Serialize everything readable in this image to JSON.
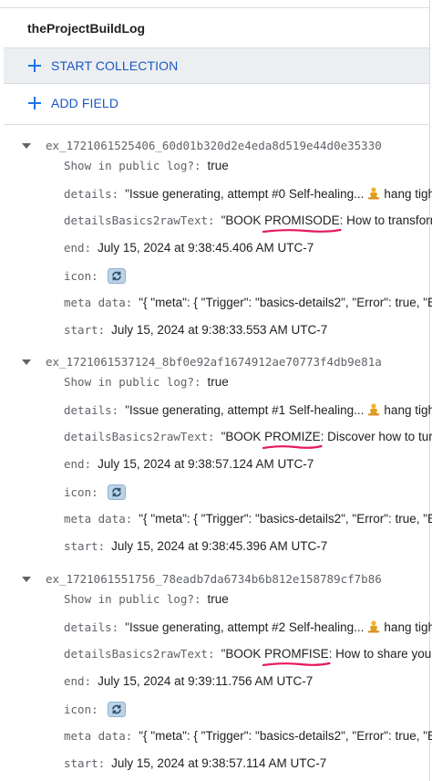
{
  "header": {
    "title": "theProjectBuildLog"
  },
  "actions": {
    "start_collection": "START COLLECTION",
    "add_field": "ADD FIELD"
  },
  "labels": {
    "show_in_public_log": "Show in public log?:",
    "details": "details:",
    "details_basics": "detailsBasics2rawText:",
    "end": "end:",
    "icon": "icon:",
    "meta_data": "meta data:",
    "start": "start:"
  },
  "documents": [
    {
      "id": "ex_1721061525406_60d01b320d2e4eda8d519e44d0e35330",
      "show_in_public_log": "true",
      "details_pre": "\"Issue generating, attempt #0 Self-healing...",
      "details_post": "hang tight!\"",
      "raw_pre": "\"BOOK ",
      "raw_hl": "PROMISODE",
      "raw_post": ": How to transform you",
      "end": "July 15, 2024 at 9:38:45.406 AM UTC-7",
      "meta_data": "\"{ \"meta\": { \"Trigger\": \"basics-details2\", \"Error\": true, \"Executi",
      "start": "July 15, 2024 at 9:38:33.553 AM UTC-7"
    },
    {
      "id": "ex_1721061537124_8bf0e92af1674912ae70773f4db9e81a",
      "show_in_public_log": "true",
      "details_pre": "\"Issue generating, attempt #1 Self-healing...",
      "details_post": "hang tight!\"",
      "raw_pre": "\"BOOK ",
      "raw_hl": "PROMIZE",
      "raw_post": ": Discover how to turn you",
      "end": "July 15, 2024 at 9:38:57.124 AM UTC-7",
      "meta_data": "\"{ \"meta\": { \"Trigger\": \"basics-details2\", \"Error\": true, \"Executi",
      "start": "July 15, 2024 at 9:38:45.396 AM UTC-7"
    },
    {
      "id": "ex_1721061551756_78eadb7da6734b6b812e158789cf7b86",
      "show_in_public_log": "true",
      "details_pre": "\"Issue generating, attempt #2 Self-healing...",
      "details_post": "hang tight!\"",
      "raw_pre": "\"BOOK ",
      "raw_hl": "PROMFISE",
      "raw_post": ": How to share your uniq",
      "end": "July 15, 2024 at 9:39:11.756 AM UTC-7",
      "meta_data": "\"{ \"meta\": { \"Trigger\": \"basics-details2\", \"Error\": true, \"Executi",
      "start": "July 15, 2024 at 9:38:57.114 AM UTC-7"
    }
  ],
  "colors": {
    "accent": "#1a73e8",
    "annotation": "#e8175d",
    "panel": "#eceff1"
  }
}
